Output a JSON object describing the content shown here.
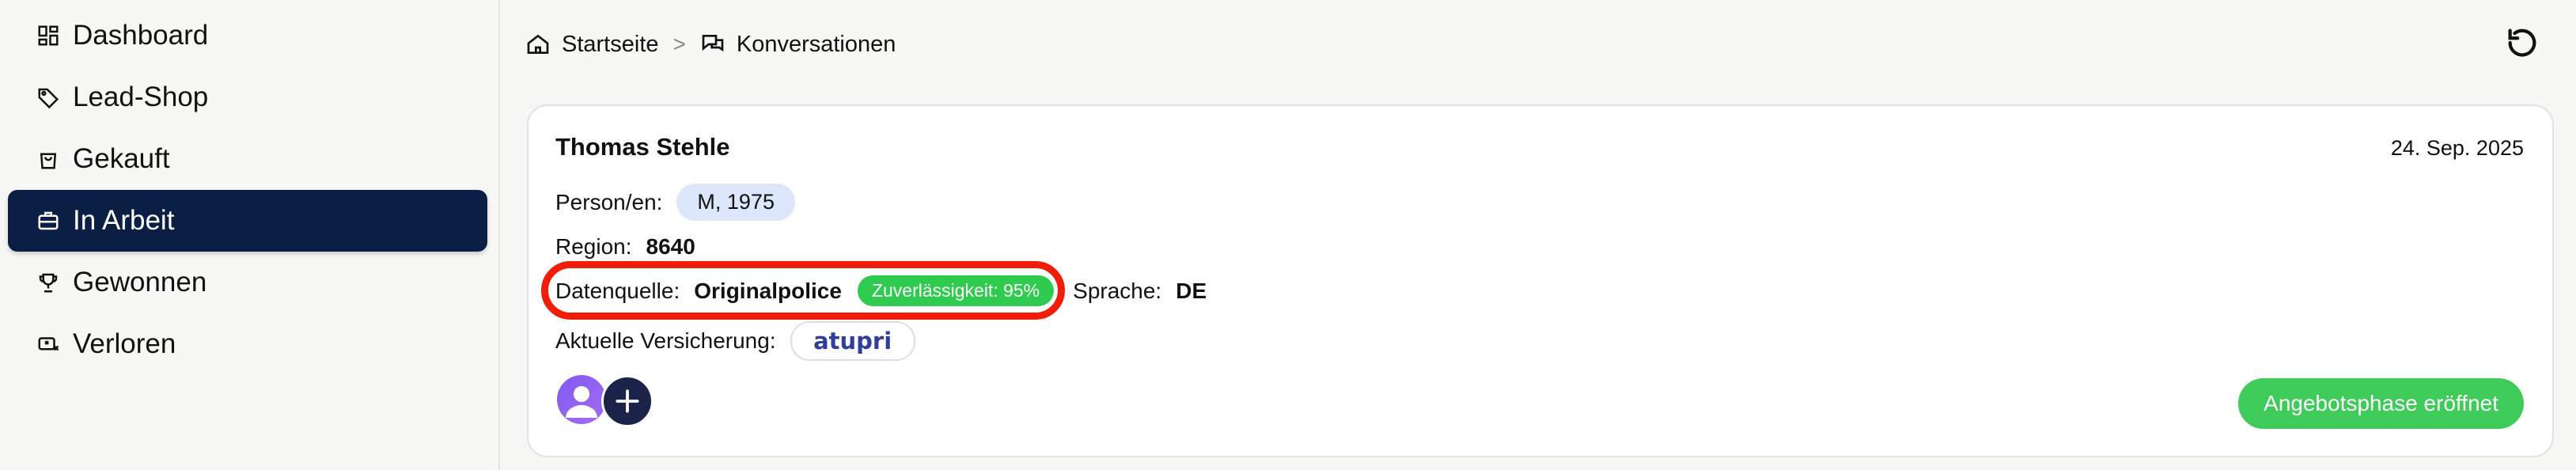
{
  "sidebar": {
    "items": [
      {
        "label": "Dashboard",
        "icon": "dashboard-icon"
      },
      {
        "label": "Lead-Shop",
        "icon": "tag-icon"
      },
      {
        "label": "Gekauft",
        "icon": "shopping-bag-icon"
      },
      {
        "label": "In Arbeit",
        "icon": "briefcase-icon",
        "active": true
      },
      {
        "label": "Gewonnen",
        "icon": "trophy-icon"
      },
      {
        "label": "Verloren",
        "icon": "ticket-x-icon"
      }
    ],
    "active_color": "#0b1f44"
  },
  "breadcrumb": {
    "home_label": "Startseite",
    "separator": ">",
    "current_label": "Konversationen"
  },
  "card": {
    "name": "Thomas Stehle",
    "date": "24. Sep. 2025",
    "persons_label": "Person/en:",
    "persons_value": "M, 1975",
    "region_label": "Region:",
    "region_value": "8640",
    "source_label": "Datenquelle:",
    "source_value": "Originalpolice",
    "reliability_badge": "Zuverlässigkeit: 95%",
    "language_label": "Sprache:",
    "language_value": "DE",
    "insurance_label": "Aktuelle Versicherung:",
    "insurance_logo": "atupri",
    "status_button": "Angebotsphase eröffnet"
  },
  "colors": {
    "highlight": "#f01d0b",
    "badge_green": "#2fcb4e",
    "status_green": "#3fcb59",
    "pill_blue": "#dce7fb"
  }
}
